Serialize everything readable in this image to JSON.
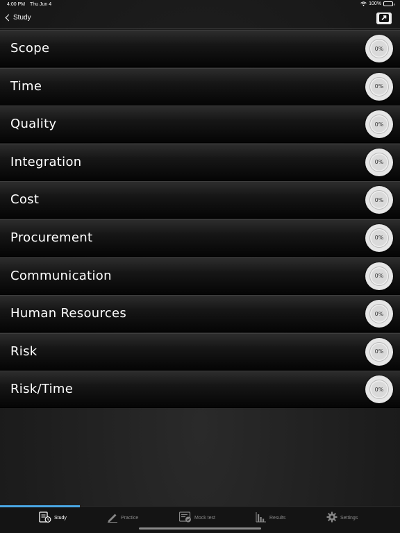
{
  "status_bar": {
    "time": "4:00 PM",
    "date": "Thu Jun 4",
    "battery": "100%"
  },
  "nav": {
    "back_label": "Study",
    "share_icon": "share-arrow-icon"
  },
  "topics": [
    {
      "label": "Scope",
      "progress": "0%"
    },
    {
      "label": "Time",
      "progress": "0%"
    },
    {
      "label": "Quality",
      "progress": "0%"
    },
    {
      "label": "Integration",
      "progress": "0%"
    },
    {
      "label": "Cost",
      "progress": "0%"
    },
    {
      "label": "Procurement",
      "progress": "0%"
    },
    {
      "label": "Communication",
      "progress": "0%"
    },
    {
      "label": "Human Resources",
      "progress": "0%"
    },
    {
      "label": "Risk",
      "progress": "0%"
    },
    {
      "label": "Risk/Time",
      "progress": "0%"
    }
  ],
  "tabs": [
    {
      "label": "Study",
      "icon": "study-icon",
      "active": true
    },
    {
      "label": "Practice",
      "icon": "pencil-icon",
      "active": false
    },
    {
      "label": "Mock test",
      "icon": "mock-test-icon",
      "active": false
    },
    {
      "label": "Results",
      "icon": "bar-chart-icon",
      "active": false
    },
    {
      "label": "Settings",
      "icon": "gear-icon",
      "active": false
    }
  ],
  "colors": {
    "accent": "#4aa8e6",
    "background": "#1c1c1c"
  }
}
